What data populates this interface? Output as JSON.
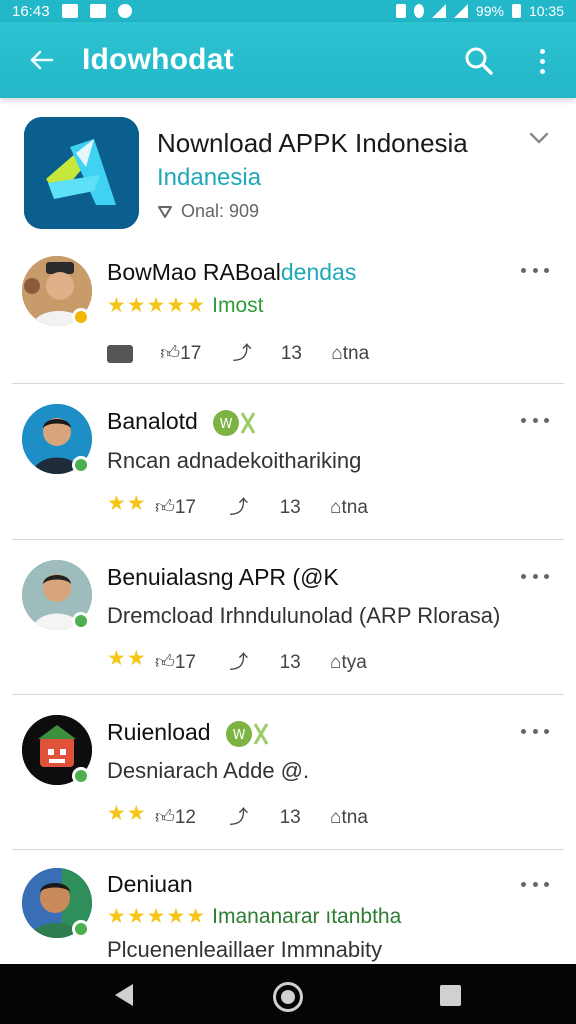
{
  "status_bar": {
    "time": "16:43",
    "battery": "99%",
    "clock": "10:35"
  },
  "app_bar": {
    "title": "Idowhodat"
  },
  "app_header": {
    "name": "Nownload APPK Indonesia",
    "subtitle": "Indanesia",
    "meta": "Onal: 909"
  },
  "reviews": [
    {
      "name": "BowMao RABoal",
      "name_accent": "dendas",
      "rating": 5,
      "stars": "★★★★★",
      "rating_text": "Imost",
      "actions": [
        "17",
        "13",
        "tna"
      ]
    },
    {
      "name": "Banalotd",
      "text": "Rncan adnadekoithariking",
      "rating": 2,
      "stars": "★★",
      "actions": [
        "17",
        "13",
        "tna"
      ]
    },
    {
      "name": "Benuialasng APR (@K",
      "text": "Dremcload Irhndulunolad (ARP Rlorasa)",
      "rating": 2,
      "stars": "★★",
      "actions": [
        "17",
        "13",
        "tya"
      ]
    },
    {
      "name": "Ruienload",
      "text": "Desniarach Adde @.",
      "rating": 2,
      "stars": "★★",
      "actions": [
        "12",
        "13",
        "tna"
      ]
    },
    {
      "name": "Deniuan",
      "rating": 5,
      "stars": "★★★★★",
      "rating_text": "Imananarar ıtanbtha",
      "text": "Plcuenenleaillaer Immnabity"
    }
  ],
  "colors": {
    "accent": "#23b8c9",
    "star": "#f5c518",
    "green": "#2e9c3a"
  }
}
